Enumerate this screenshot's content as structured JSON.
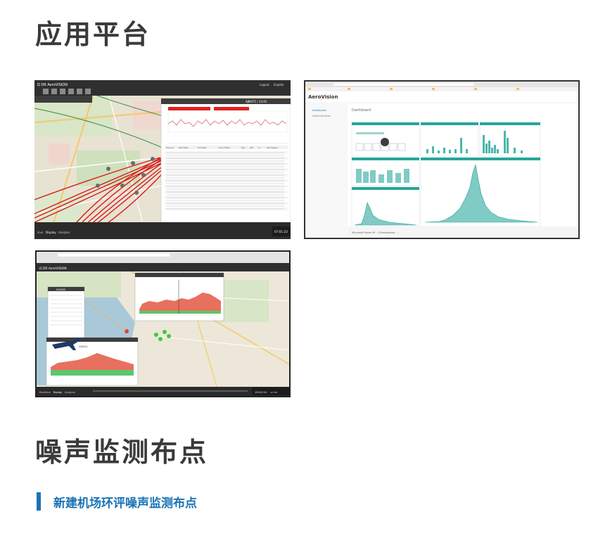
{
  "section1": {
    "title": "应用平台"
  },
  "section2": {
    "title": "噪声监测布点",
    "subheading": "新建机场环评噪声监测布点"
  },
  "screenshot1": {
    "brand": "Ω DR AeroVISION",
    "top_right": [
      "Logout",
      "English"
    ],
    "panel_id": "AJM471 / 13:01",
    "tabs": [
      "Live",
      "Display",
      "Analysis"
    ],
    "time": "07:01:23",
    "table_headers": [
      "Channel",
      "Start Date",
      "End Date",
      "Time of Max",
      "Max",
      "LEQ",
      "L1",
      "Wind Speed"
    ]
  },
  "screenshot2": {
    "brand": "AeroVision",
    "page_title": "Dashboard",
    "sidebar": [
      "Dashboard",
      "Administration"
    ],
    "footer_text": "Microsoft Power BI · 3 Dashboards, ..."
  },
  "screenshot3": {
    "brand": "Ω DR AeroVISION",
    "popup_title": "AS5403",
    "flight_label": "UA5421",
    "tabs": [
      "Realtime",
      "Replay",
      "Analysis"
    ],
    "time": "19:22:14",
    "speed": "x2 TIM"
  }
}
